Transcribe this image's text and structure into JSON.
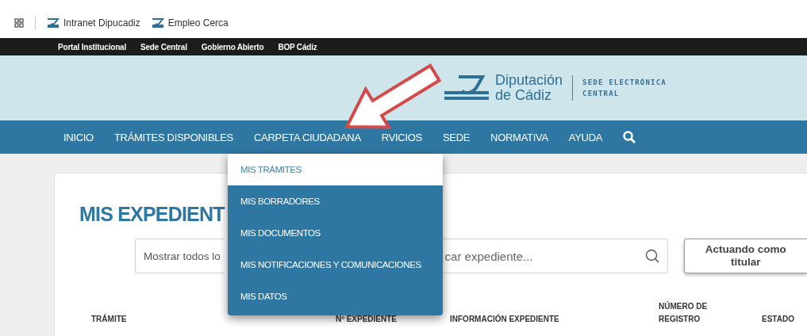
{
  "bookmarks_bar": {
    "items": [
      {
        "label": "Intranet Dipucadiz"
      },
      {
        "label": "Empleo Cerca"
      }
    ]
  },
  "top_links": [
    "Portal Institucional",
    "Sede Central",
    "Gobierno Abierto",
    "BOP Cádiz"
  ],
  "header": {
    "logo_lines": [
      "Diputación",
      "de Cádiz"
    ],
    "sede_lines": [
      "SEDE ELECTRÓNICA",
      "CENTRAL"
    ]
  },
  "nav": {
    "items": [
      "INICIO",
      "TRÁMITES DISPONIBLES",
      "CARPETA CIUDADANA",
      "RVICIOS",
      "SEDE",
      "NORMATIVA",
      "AYUDA"
    ]
  },
  "dropdown": {
    "items": [
      {
        "label": "MIS TRÁMITES",
        "selected": true
      },
      {
        "label": "MIS BORRADORES",
        "selected": false
      },
      {
        "label": "MIS DOCUMENTOS",
        "selected": false
      },
      {
        "label": "MIS NOTIFICACIONES Y COMUNICACIONES",
        "selected": false
      },
      {
        "label": "MIS DATOS",
        "selected": false
      }
    ]
  },
  "page": {
    "title": "MIS EXPEDIENT",
    "filter_select": {
      "value": "Mostrar todos lo"
    },
    "search": {
      "placeholder": "car expediente..."
    },
    "acting_button": "Actuando como titular",
    "table": {
      "columns": [
        "TRÁMITE",
        "Nº EXPEDIENTE",
        "INFORMACIÓN EXPEDIENTE",
        "NÚMERO DE REGISTRO",
        "ESTADO"
      ]
    }
  }
}
